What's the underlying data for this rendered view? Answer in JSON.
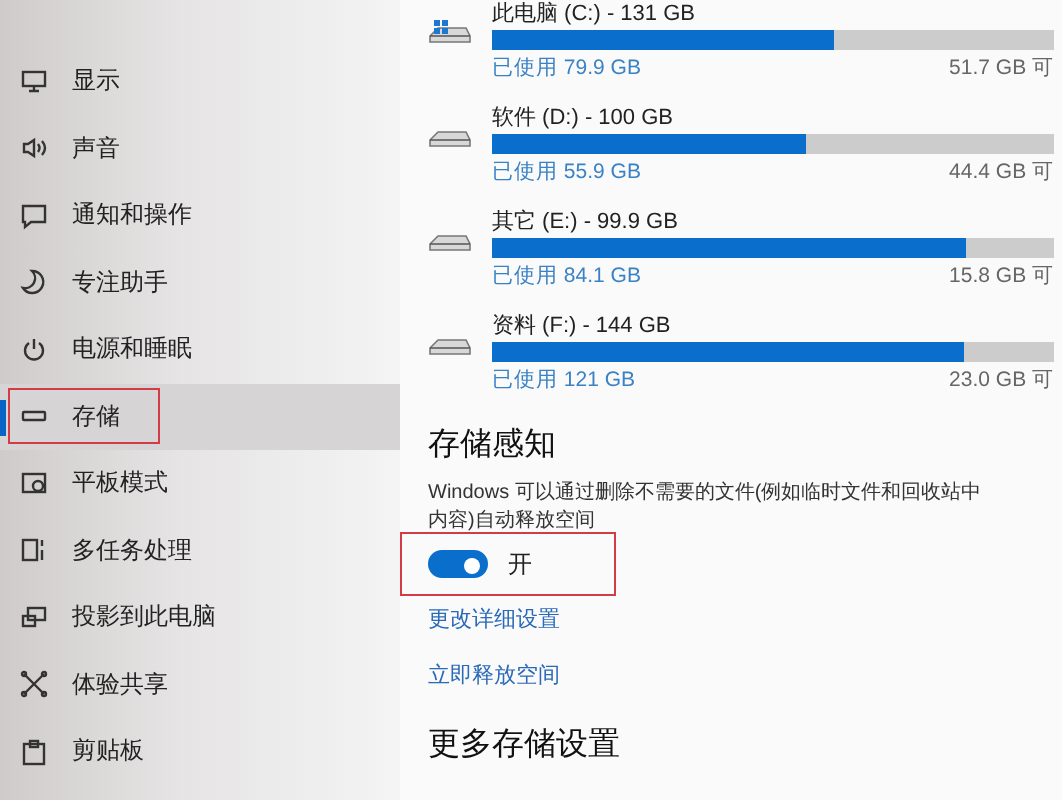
{
  "sidebar": {
    "items": [
      {
        "label": "显示",
        "selected": false,
        "highlighted": false
      },
      {
        "label": "声音",
        "selected": false,
        "highlighted": false
      },
      {
        "label": "通知和操作",
        "selected": false,
        "highlighted": false
      },
      {
        "label": "专注助手",
        "selected": false,
        "highlighted": false
      },
      {
        "label": "电源和睡眠",
        "selected": false,
        "highlighted": false
      },
      {
        "label": "存储",
        "selected": true,
        "highlighted": true
      },
      {
        "label": "平板模式",
        "selected": false,
        "highlighted": false
      },
      {
        "label": "多任务处理",
        "selected": false,
        "highlighted": false
      },
      {
        "label": "投影到此电脑",
        "selected": false,
        "highlighted": false
      },
      {
        "label": "体验共享",
        "selected": false,
        "highlighted": false
      },
      {
        "label": "剪贴板",
        "selected": false,
        "highlighted": false
      }
    ]
  },
  "drives": [
    {
      "kind": "system",
      "name": "此电脑 (C:) - 131 GB",
      "level": 0.61,
      "used": "已使用 79.9 GB",
      "free": "51.7 GB 可"
    },
    {
      "kind": "disk",
      "name": "软件 (D:) - 100 GB",
      "level": 0.559,
      "used": "已使用 55.9 GB",
      "free": "44.4 GB 可"
    },
    {
      "kind": "disk",
      "name": "其它 (E:) - 99.9 GB",
      "level": 0.842,
      "used": "已使用 84.1 GB",
      "free": "15.8 GB 可"
    },
    {
      "kind": "disk",
      "name": "资料 (F:) - 144 GB",
      "level": 0.84,
      "used": "已使用 121 GB",
      "free": "23.0 GB 可"
    }
  ],
  "storage_sense": {
    "title": "存储感知",
    "description": [
      "Windows 可以通过删除不需要的文件(例如临时文件和回收站中",
      "内容)自动释放空间"
    ],
    "toggle": {
      "on": true,
      "label": "开",
      "highlighted": true
    },
    "links": [
      "更改详细设置",
      "立即释放空间"
    ]
  },
  "more_settings": {
    "title": "更多存储设置"
  }
}
